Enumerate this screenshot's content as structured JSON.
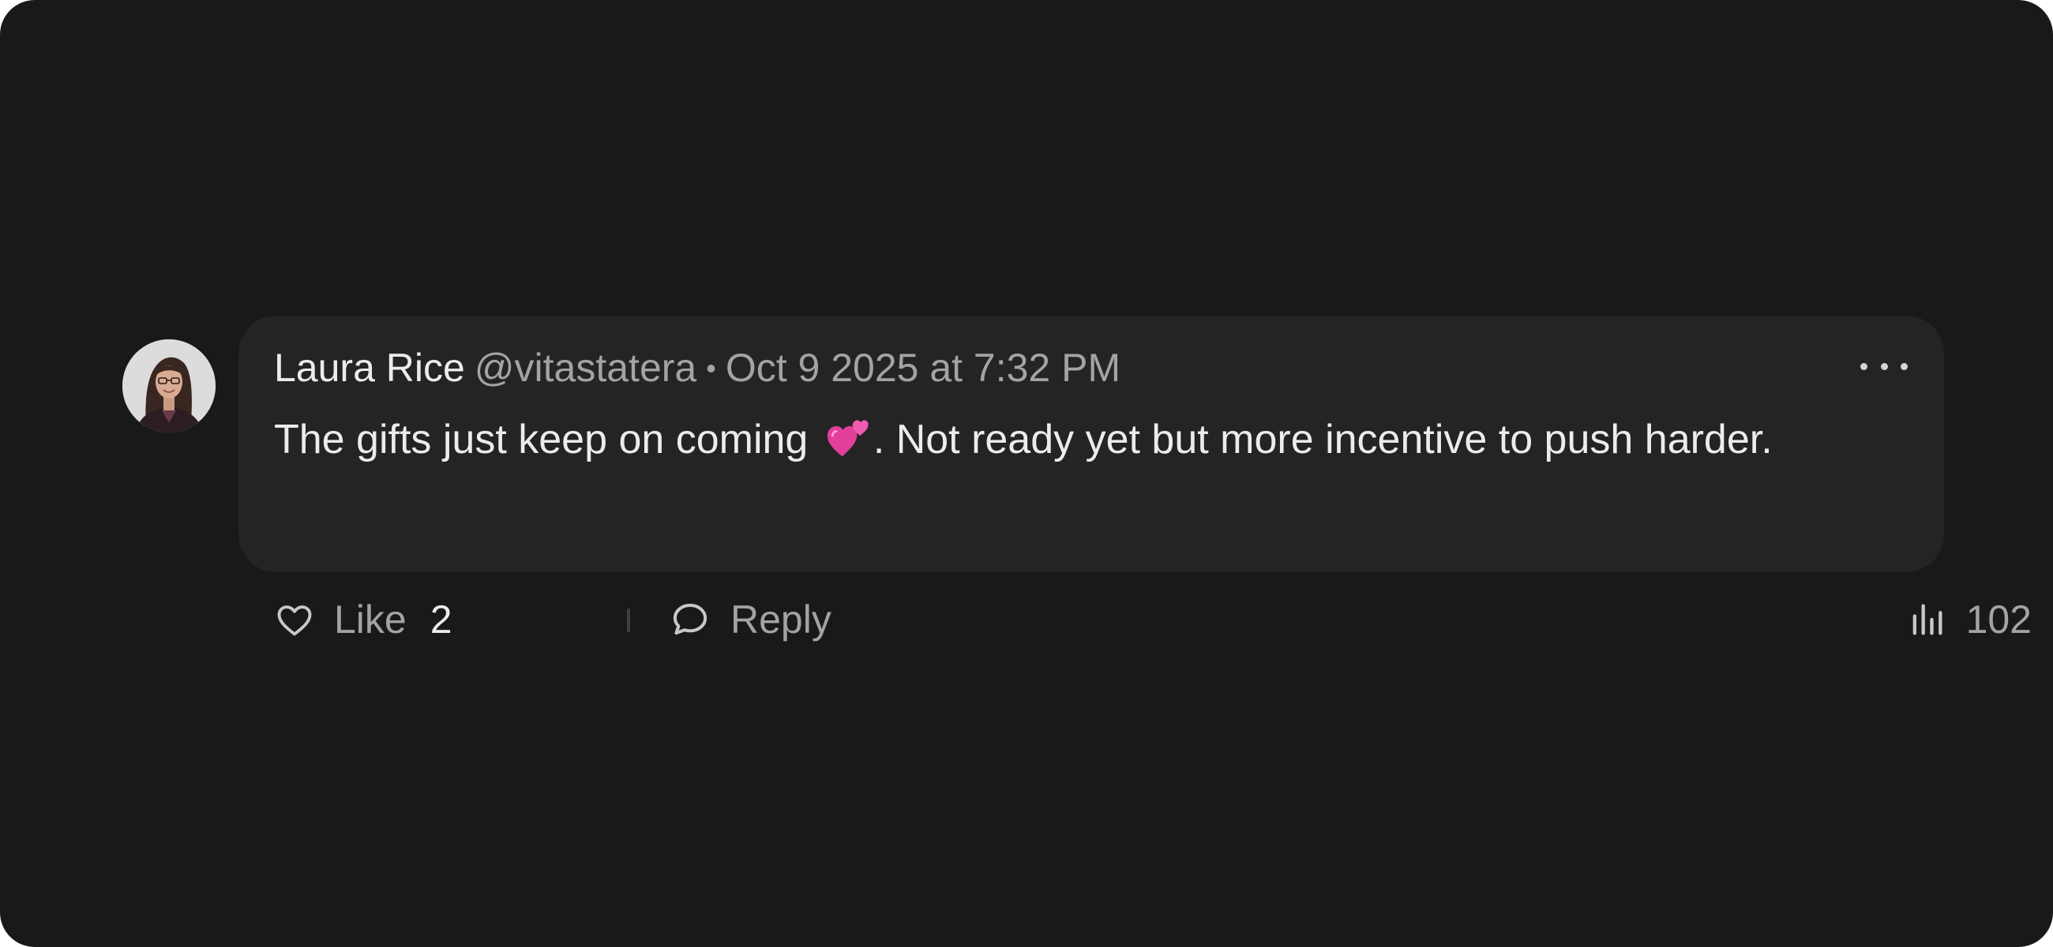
{
  "comment": {
    "author": "Laura Rice",
    "handle": "@vitastatera",
    "separator": "•",
    "timestamp": "Oct 9 2025 at 7:32 PM",
    "body_before_emoji": "The gifts just keep on coming",
    "emoji": "two-hearts",
    "body_after_emoji": ". Not ready yet but more incentive to push harder.",
    "more_icon": "ellipsis-icon",
    "avatar": "user-photo-avatar"
  },
  "actions": {
    "like_label": "Like",
    "like_count": "2",
    "like_icon": "heart-outline-icon",
    "reply_label": "Reply",
    "reply_icon": "speech-bubble-icon",
    "views_count": "102",
    "views_icon": "bar-chart-icon"
  },
  "colors": {
    "background": "#191919",
    "bubble": "#242424",
    "primary_text": "#ececec",
    "secondary_text": "#a3a3a3",
    "heart_emoji": "#e23f9a"
  }
}
